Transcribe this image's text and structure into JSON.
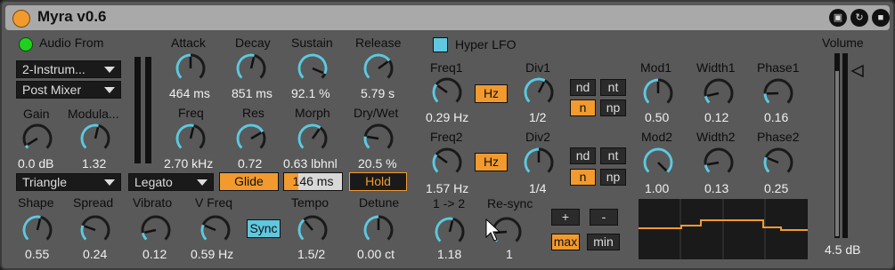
{
  "title": "Myra v0.6",
  "titlebar_icons": [
    "map-icon",
    "refresh-icon",
    "save-icon"
  ],
  "audio_from": {
    "label": "Audio From",
    "source": "2-Instrum...",
    "tap": "Post Mixer"
  },
  "gain": {
    "label": "Gain",
    "value": "0.0 dB"
  },
  "modulation": {
    "label": "Modula...",
    "value": "1.32"
  },
  "waveform": "Triangle",
  "shape": {
    "label": "Shape",
    "value": "0.55"
  },
  "spread": {
    "label": "Spread",
    "value": "0.24"
  },
  "envelope": {
    "attack": {
      "label": "Attack",
      "value": "464 ms"
    },
    "decay": {
      "label": "Decay",
      "value": "851 ms"
    },
    "sustain": {
      "label": "Sustain",
      "value": "92.1 %"
    },
    "release": {
      "label": "Release",
      "value": "5.79 s"
    }
  },
  "filter": {
    "freq": {
      "label": "Freq",
      "value": "2.70 kHz"
    },
    "res": {
      "label": "Res",
      "value": "0.72"
    },
    "morph": {
      "label": "Morph",
      "value": "0.63 lbhnl"
    },
    "drywet": {
      "label": "Dry/Wet",
      "value": "20.5 %"
    }
  },
  "voice_mode": "Legato",
  "glide": {
    "label": "Glide",
    "time": "146 ms"
  },
  "hold": "Hold",
  "vibrato": {
    "label": "Vibrato",
    "value": "0.12"
  },
  "vfreq": {
    "label": "V Freq",
    "value": "0.59 Hz"
  },
  "sync": "Sync",
  "tempo": {
    "label": "Tempo",
    "value": "1.5/2"
  },
  "detune": {
    "label": "Detune",
    "value": "0.00 ct"
  },
  "hyper_lfo": {
    "label": "Hyper LFO",
    "freq1": {
      "label": "Freq1",
      "value": "0.29 Hz"
    },
    "freq2": {
      "label": "Freq2",
      "value": "1.57 Hz"
    },
    "hz_label": "Hz",
    "div1": {
      "label": "Div1",
      "value": "1/2"
    },
    "div2": {
      "label": "Div2",
      "value": "1/4"
    },
    "mode_buttons": [
      "nd",
      "nt",
      "n",
      "np"
    ],
    "ratio": {
      "label": "1 -> 2",
      "value": "1.18"
    },
    "resync": {
      "label": "Re-sync",
      "value": "1"
    },
    "plus": "+",
    "minus": "-",
    "max": "max",
    "min": "min"
  },
  "mod1": {
    "label": "Mod1",
    "value": "0.50"
  },
  "width1": {
    "label": "Width1",
    "value": "0.12"
  },
  "phase1": {
    "label": "Phase1",
    "value": "0.16"
  },
  "mod2": {
    "label": "Mod2",
    "value": "1.00"
  },
  "width2": {
    "label": "Width2",
    "value": "0.13"
  },
  "phase2": {
    "label": "Phase2",
    "value": "0.25"
  },
  "volume": {
    "label": "Volume",
    "value": "4.5 dB",
    "level": 0.93
  },
  "colors": {
    "accent": "#f29a2e",
    "knob_arc": "#5fc8df",
    "background": "#595959",
    "title": "#a9a9a9"
  }
}
